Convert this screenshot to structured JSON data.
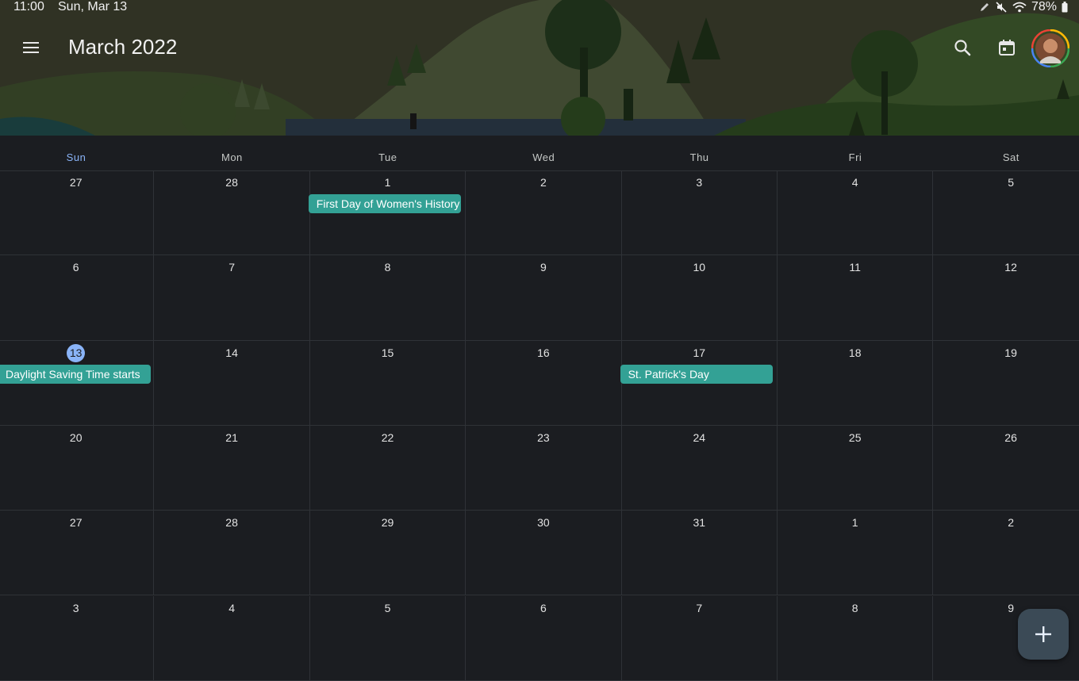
{
  "status_bar": {
    "time": "11:00",
    "date": "Sun, Mar 13",
    "battery": "78%"
  },
  "header": {
    "title": "March 2022",
    "today_icon_day": "13"
  },
  "weekdays": [
    "Sun",
    "Mon",
    "Tue",
    "Wed",
    "Thu",
    "Fri",
    "Sat"
  ],
  "weeks": [
    [
      "27",
      "28",
      "1",
      "2",
      "3",
      "4",
      "5"
    ],
    [
      "6",
      "7",
      "8",
      "9",
      "10",
      "11",
      "12"
    ],
    [
      "13",
      "14",
      "15",
      "16",
      "17",
      "18",
      "19"
    ],
    [
      "20",
      "21",
      "22",
      "23",
      "24",
      "25",
      "26"
    ],
    [
      "27",
      "28",
      "29",
      "30",
      "31",
      "1",
      "2"
    ],
    [
      "3",
      "4",
      "5",
      "6",
      "7",
      "8",
      "9"
    ]
  ],
  "today": {
    "week": 2,
    "day": 0
  },
  "events": [
    {
      "title": "First Day of Women's History Month",
      "week": 0,
      "day": 2
    },
    {
      "title": "Daylight Saving Time starts",
      "week": 2,
      "day": 0
    },
    {
      "title": "St. Patrick's Day",
      "week": 2,
      "day": 4
    }
  ],
  "colors": {
    "background": "#1b1d21",
    "event": "#33a195",
    "today_accent": "#8ab4f8",
    "fab": "#3b4a56"
  },
  "icons": {
    "menu": "hamburger-menu-icon",
    "search": "search-icon",
    "today": "calendar-today-icon",
    "add": "plus-icon"
  }
}
